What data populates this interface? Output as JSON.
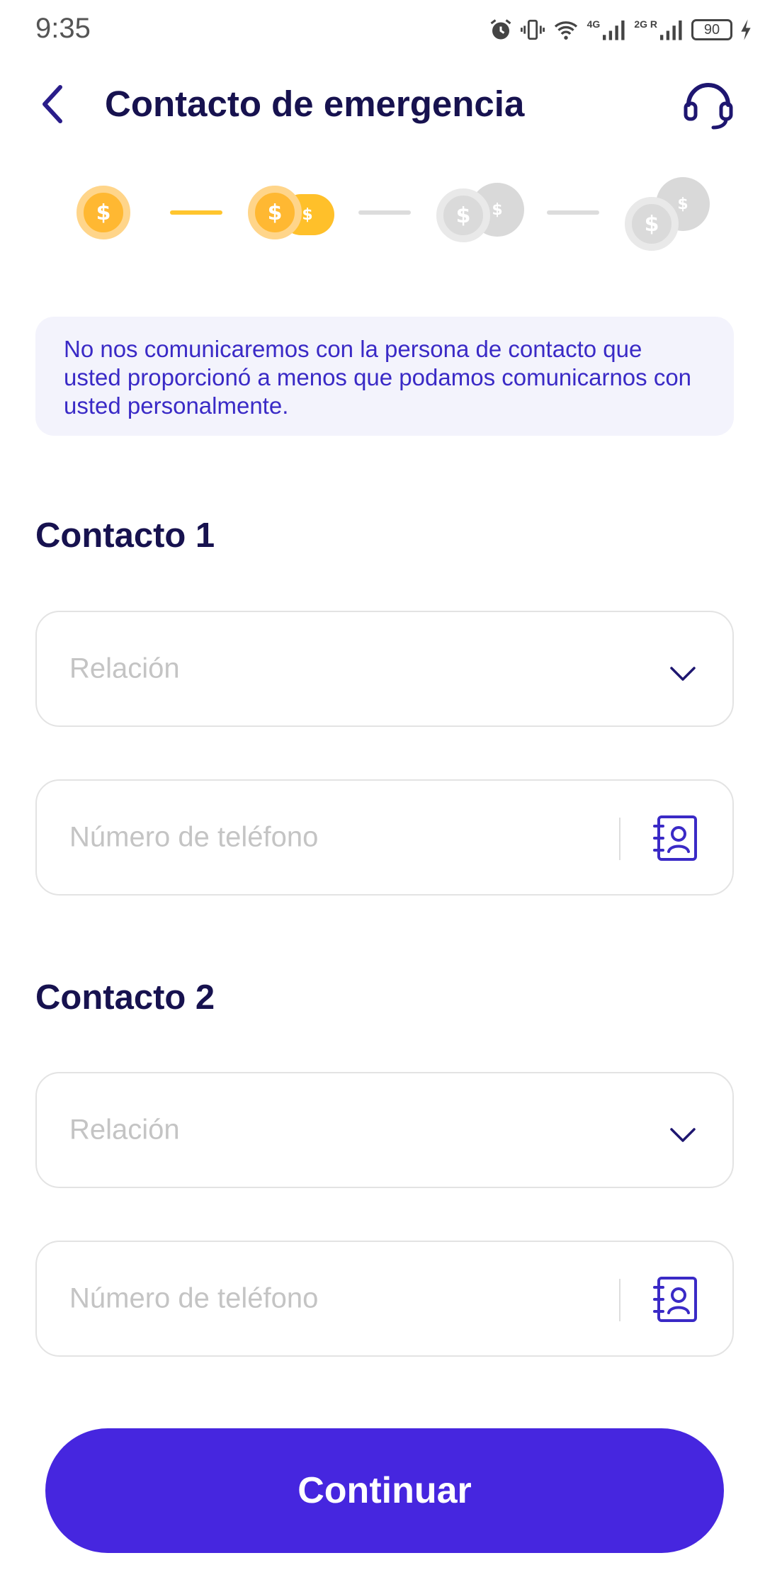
{
  "status_bar": {
    "time": "9:35",
    "network_4g": "4G",
    "network_2g": "2G R",
    "battery": "90",
    "icons": [
      "alarm-icon",
      "vibrate-icon",
      "wifi-icon",
      "signal-icon",
      "signal-icon",
      "battery-icon",
      "charging-icon"
    ]
  },
  "header": {
    "title": "Contacto de emergencia",
    "back_icon": "chevron-left-icon",
    "support_icon": "headset-icon"
  },
  "progress": {
    "current_step": 2,
    "total_steps": 4,
    "coin_symbol": "$",
    "active_color": "#ffb832",
    "inactive_color": "#dadada"
  },
  "notice": {
    "text": "No nos comunicaremos con la persona de contacto que usted proporcionó a menos que podamos comunicarnos con usted personalmente."
  },
  "contacts": [
    {
      "title": "Contacto 1",
      "relation_placeholder": "Relación",
      "phone_placeholder": "Número de teléfono"
    },
    {
      "title": "Contacto 2",
      "relation_placeholder": "Relación",
      "phone_placeholder": "Número de teléfono"
    }
  ],
  "continue_label": "Continuar",
  "colors": {
    "primary": "#4626df",
    "heading": "#17124f",
    "notice_bg": "#f3f3fc",
    "notice_text": "#3a2ac6"
  }
}
